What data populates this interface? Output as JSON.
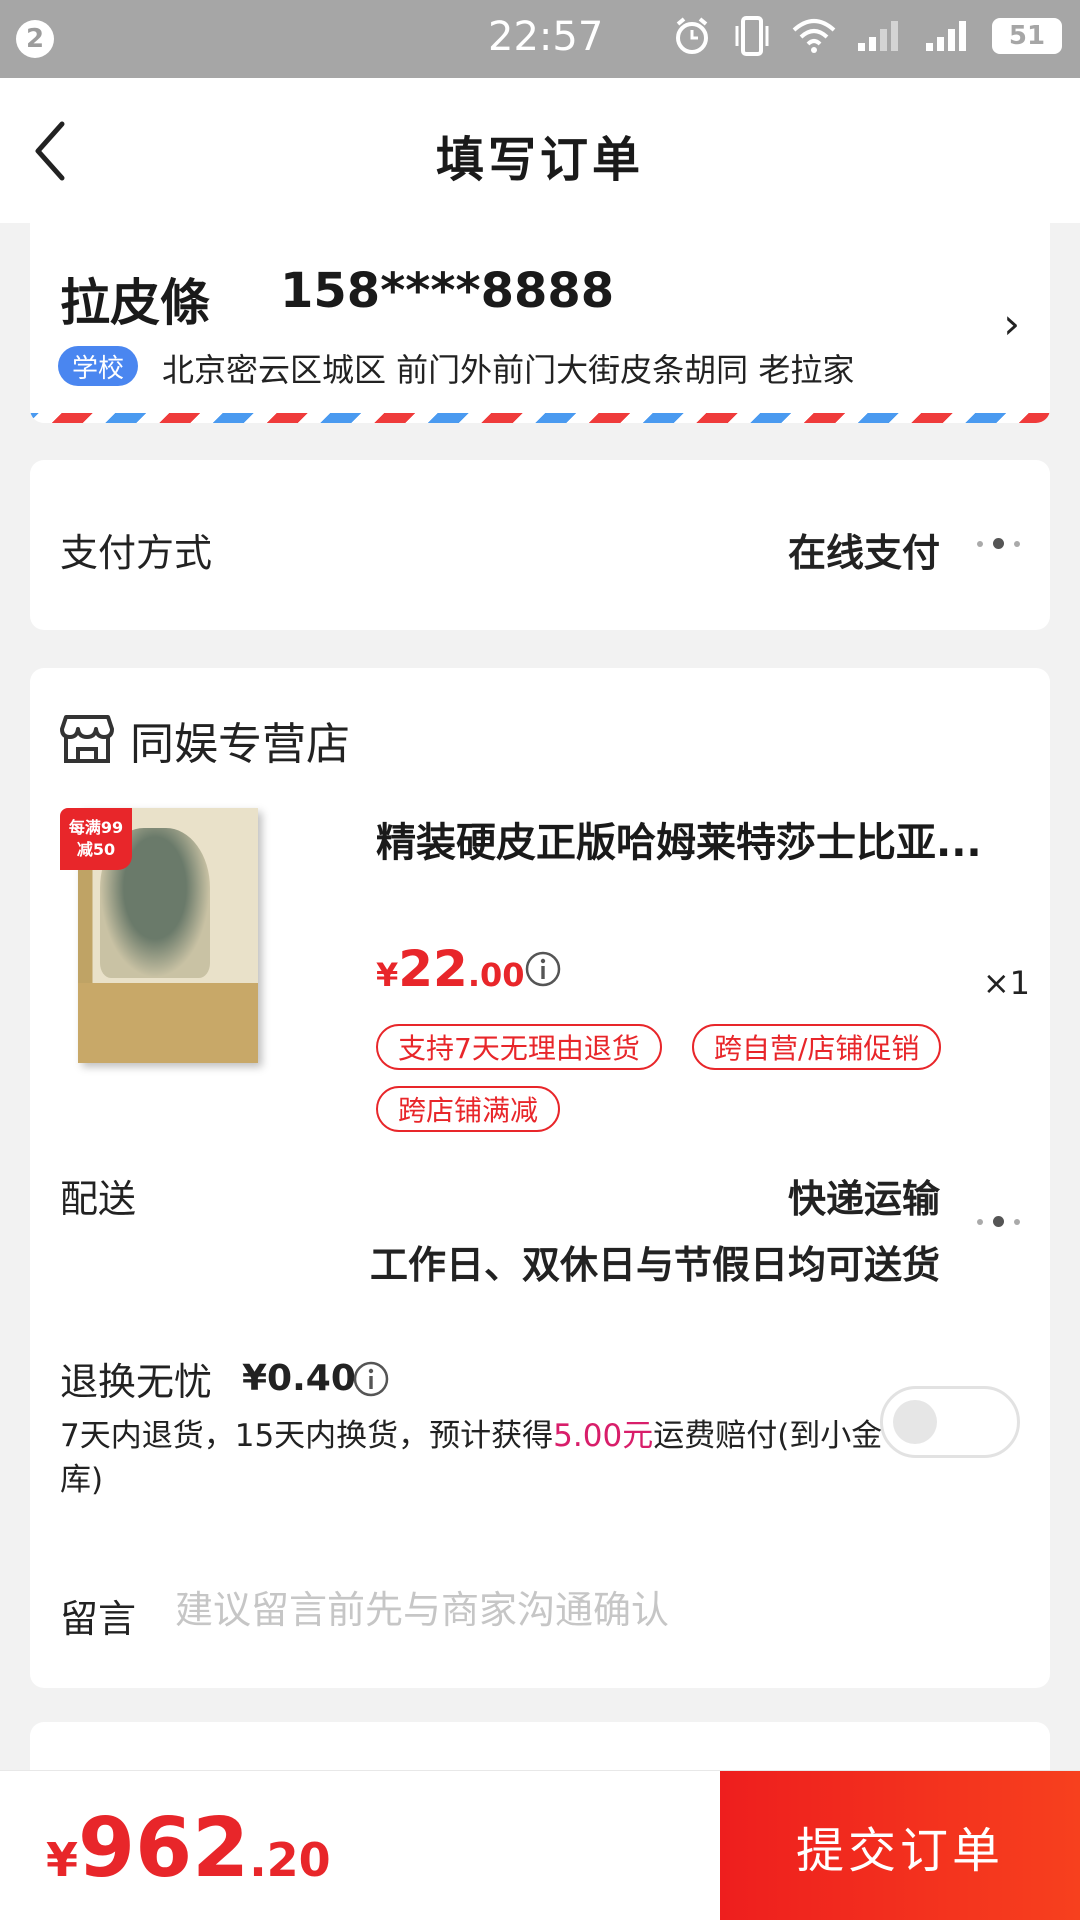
{
  "status_bar": {
    "notification_count": "2",
    "time": "22:57",
    "battery": "51",
    "icons": [
      "alarm-icon",
      "vibrate-icon",
      "wifi-icon",
      "signal-icon",
      "signal-icon",
      "battery-icon"
    ]
  },
  "header": {
    "title": "填写订单",
    "back_icon": "chevron-left-icon"
  },
  "address": {
    "name": "拉皮條",
    "phone": "158****8888",
    "tag": "学校",
    "text": "北京密云区城区 前门外前门大街皮条胡同 老拉家",
    "chevron": "›"
  },
  "payment": {
    "label": "支付方式",
    "value": "在线支付"
  },
  "shop": {
    "name": "同娱专营店",
    "icon": "store-icon"
  },
  "product": {
    "badge_line1": "每满99",
    "badge_line2": "减50",
    "title": "精装硬皮正版哈姆莱特莎士比亚...",
    "price_currency": "¥",
    "price_int": "22",
    "price_dec": ".00",
    "quantity": "×1",
    "tags": [
      "支持7天无理由退货",
      "跨自营/店铺促销",
      "跨店铺满减"
    ]
  },
  "delivery": {
    "label": "配送",
    "method": "快递运输",
    "schedule": "工作日、双休日与节假日均可送货"
  },
  "return_service": {
    "label": "退换无忧",
    "price": "¥0.40",
    "desc_before": "7天内退货，15天内换货，预计获得",
    "desc_highlight": "5.00元",
    "desc_after": "运费赔付(到小金库)",
    "enabled": false
  },
  "message": {
    "label": "留言",
    "placeholder": "建议留言前先与商家沟通确认",
    "value": ""
  },
  "footer": {
    "total_currency": "¥",
    "total_int": "962",
    "total_dec": ".20",
    "submit_label": "提交订单"
  },
  "colors": {
    "accent_red": "#e8262a",
    "tag_blue": "#4a86f0",
    "highlight_pink": "#d81e6a"
  }
}
